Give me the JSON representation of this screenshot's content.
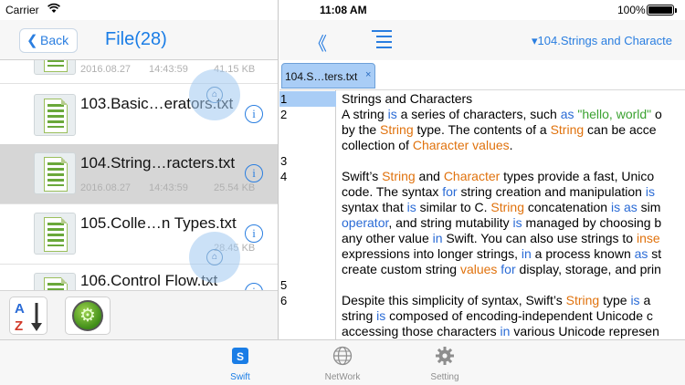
{
  "status_bar": {
    "carrier": "Carrier",
    "time": "11:08 AM",
    "battery": "100%"
  },
  "left_nav": {
    "back_label": "Back",
    "title": "File(28)"
  },
  "files": [
    {
      "name": "",
      "date": "2016.08.27",
      "time": "14:43:59",
      "size": "41.15 KB",
      "selected": false
    },
    {
      "name": "103.Basic…erators.txt",
      "date": "",
      "time": "",
      "size": "",
      "selected": false
    },
    {
      "name": "104.String…racters.txt",
      "date": "2016.08.27",
      "time": "14:43:59",
      "size": "25.54 KB",
      "selected": true
    },
    {
      "name": "105.Colle…n Types.txt",
      "date": "",
      "time": "",
      "size": "28.45 KB",
      "selected": false
    },
    {
      "name": "106.Control Flow.txt",
      "date": "",
      "time": "",
      "size": "",
      "selected": false
    }
  ],
  "info_glyph": "i",
  "left_toolbar": {
    "sort_icon": "sort-az-icon",
    "settings_icon": "gear-icon"
  },
  "right_nav": {
    "collapse_icon": "double-chevron-left-icon",
    "outline_icon": "outline-list-icon",
    "doc_title": "▾104.Strings and Characte"
  },
  "doc_tab": {
    "label": "104.S…ters.txt",
    "close": "×"
  },
  "line_numbers": [
    "1",
    "2",
    "3",
    "4",
    "5",
    "6"
  ],
  "code_lines": [
    [
      {
        "t": "Strings and Characters",
        "c": ""
      }
    ],
    [
      {
        "t": "A string ",
        "c": ""
      },
      {
        "t": "is",
        "c": "k-blue"
      },
      {
        "t": " a series of characters, such ",
        "c": ""
      },
      {
        "t": "as",
        "c": "k-blue"
      },
      {
        "t": " ",
        "c": ""
      },
      {
        "t": "\"hello, world\"",
        "c": "k-green"
      },
      {
        "t": " o",
        "c": ""
      }
    ],
    [
      {
        "t": "by the ",
        "c": ""
      },
      {
        "t": "String",
        "c": "k-orange"
      },
      {
        "t": " type. The contents of a ",
        "c": ""
      },
      {
        "t": "String",
        "c": "k-orange"
      },
      {
        "t": " can be acce",
        "c": ""
      }
    ],
    [
      {
        "t": "collection of ",
        "c": ""
      },
      {
        "t": "Character values",
        "c": "k-orange"
      },
      {
        "t": ".",
        "c": ""
      }
    ],
    [
      {
        "t": "Swift’s ",
        "c": ""
      },
      {
        "t": "String",
        "c": "k-orange"
      },
      {
        "t": " and ",
        "c": ""
      },
      {
        "t": "Character",
        "c": "k-orange"
      },
      {
        "t": " types provide a fast, Unico",
        "c": ""
      }
    ],
    [
      {
        "t": "code. The syntax ",
        "c": ""
      },
      {
        "t": "for",
        "c": "k-blue"
      },
      {
        "t": " string creation and manipulation ",
        "c": ""
      },
      {
        "t": "is",
        "c": "k-blue"
      }
    ],
    [
      {
        "t": "syntax that ",
        "c": ""
      },
      {
        "t": "is",
        "c": "k-blue"
      },
      {
        "t": " similar to C. ",
        "c": ""
      },
      {
        "t": "String",
        "c": "k-orange"
      },
      {
        "t": " concatenation ",
        "c": ""
      },
      {
        "t": "is as",
        "c": "k-blue"
      },
      {
        "t": " sim",
        "c": ""
      }
    ],
    [
      {
        "t": "operator",
        "c": "k-blue"
      },
      {
        "t": ", and string mutability ",
        "c": ""
      },
      {
        "t": "is",
        "c": "k-blue"
      },
      {
        "t": " managed by choosing b",
        "c": ""
      }
    ],
    [
      {
        "t": "any other value ",
        "c": ""
      },
      {
        "t": "in",
        "c": "k-blue"
      },
      {
        "t": " Swift. You can also use strings to ",
        "c": ""
      },
      {
        "t": "inse",
        "c": "k-orange"
      }
    ],
    [
      {
        "t": "expressions into longer strings, ",
        "c": ""
      },
      {
        "t": "in",
        "c": "k-blue"
      },
      {
        "t": " a process known ",
        "c": ""
      },
      {
        "t": "as",
        "c": "k-blue"
      },
      {
        "t": " st",
        "c": ""
      }
    ],
    [
      {
        "t": "create custom string ",
        "c": ""
      },
      {
        "t": "values",
        "c": "k-orange"
      },
      {
        "t": " ",
        "c": ""
      },
      {
        "t": "for",
        "c": "k-blue"
      },
      {
        "t": " display, storage, and prin",
        "c": ""
      }
    ],
    [
      {
        "t": "Despite this simplicity of syntax, Swift’s ",
        "c": ""
      },
      {
        "t": "String",
        "c": "k-orange"
      },
      {
        "t": " type ",
        "c": ""
      },
      {
        "t": "is",
        "c": "k-blue"
      },
      {
        "t": " a",
        "c": ""
      }
    ],
    [
      {
        "t": "string ",
        "c": ""
      },
      {
        "t": "is",
        "c": "k-blue"
      },
      {
        "t": " composed of encoding-independent Unicode c",
        "c": ""
      }
    ],
    [
      {
        "t": "accessing those characters ",
        "c": ""
      },
      {
        "t": "in",
        "c": "k-blue"
      },
      {
        "t": " various Unicode represen",
        "c": ""
      }
    ]
  ],
  "tabbar": [
    {
      "label": "Swift",
      "icon": "swift-icon",
      "active": true
    },
    {
      "label": "NetWork",
      "icon": "globe-icon",
      "active": false
    },
    {
      "label": "Setting",
      "icon": "gear-icon",
      "active": false
    }
  ],
  "colors": {
    "accent": "#1a7de6",
    "keyword": "#2a6bd6",
    "type": "#e0720d",
    "string": "#3ba231",
    "selection": "#a9cdf6"
  }
}
